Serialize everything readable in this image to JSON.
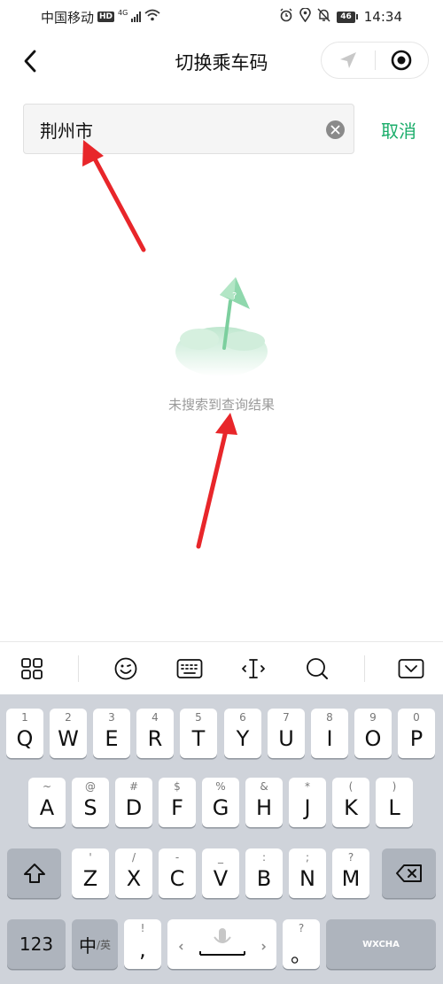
{
  "status_bar": {
    "carrier": "中国移动",
    "hd": "HD",
    "network": "4G",
    "battery": "46",
    "time": "14:34"
  },
  "nav": {
    "title": "切换乘车码"
  },
  "search": {
    "value": "荆州市",
    "cancel_label": "取消"
  },
  "empty_state": {
    "message": "未搜索到查询结果"
  },
  "keyboard": {
    "row1": [
      {
        "alt": "1",
        "key": "Q"
      },
      {
        "alt": "2",
        "key": "W"
      },
      {
        "alt": "3",
        "key": "E"
      },
      {
        "alt": "4",
        "key": "R"
      },
      {
        "alt": "5",
        "key": "T"
      },
      {
        "alt": "6",
        "key": "Y"
      },
      {
        "alt": "7",
        "key": "U"
      },
      {
        "alt": "8",
        "key": "I"
      },
      {
        "alt": "9",
        "key": "O"
      },
      {
        "alt": "0",
        "key": "P"
      }
    ],
    "row2": [
      {
        "alt": "~",
        "key": "A"
      },
      {
        "alt": "@",
        "key": "S"
      },
      {
        "alt": "#",
        "key": "D"
      },
      {
        "alt": "$",
        "key": "F"
      },
      {
        "alt": "%",
        "key": "G"
      },
      {
        "alt": "&",
        "key": "H"
      },
      {
        "alt": "*",
        "key": "J"
      },
      {
        "alt": "(",
        "key": "K"
      },
      {
        "alt": ")",
        "key": "L"
      }
    ],
    "row3": [
      {
        "alt": "'",
        "key": "Z"
      },
      {
        "alt": "/",
        "key": "X"
      },
      {
        "alt": "-",
        "key": "C"
      },
      {
        "alt": "_",
        "key": "V"
      },
      {
        "alt": ":",
        "key": "B"
      },
      {
        "alt": ";",
        "key": "N"
      },
      {
        "alt": "?",
        "key": "M"
      }
    ],
    "numbers_label": "123",
    "lang_main": "中",
    "lang_sub": "/英",
    "comma_alt": "!",
    "comma_key": ",",
    "period_alt": "?",
    "period_key": "。",
    "watermark": "WXCHA"
  },
  "icons": {
    "back": "chevron-left-icon",
    "location": "location-arrow-icon",
    "close": "record-target-icon",
    "clear": "clear-x-icon",
    "toolbar": [
      "grid-icon",
      "emoji-icon",
      "keyboard-icon",
      "cursor-icon",
      "search-icon",
      "keyboard-hide-icon"
    ]
  },
  "colors": {
    "accent": "#1aad6a",
    "annotation": "#e8262a",
    "keyboard_bg": "#cfd3da",
    "key_dark": "#aeb4bd"
  }
}
